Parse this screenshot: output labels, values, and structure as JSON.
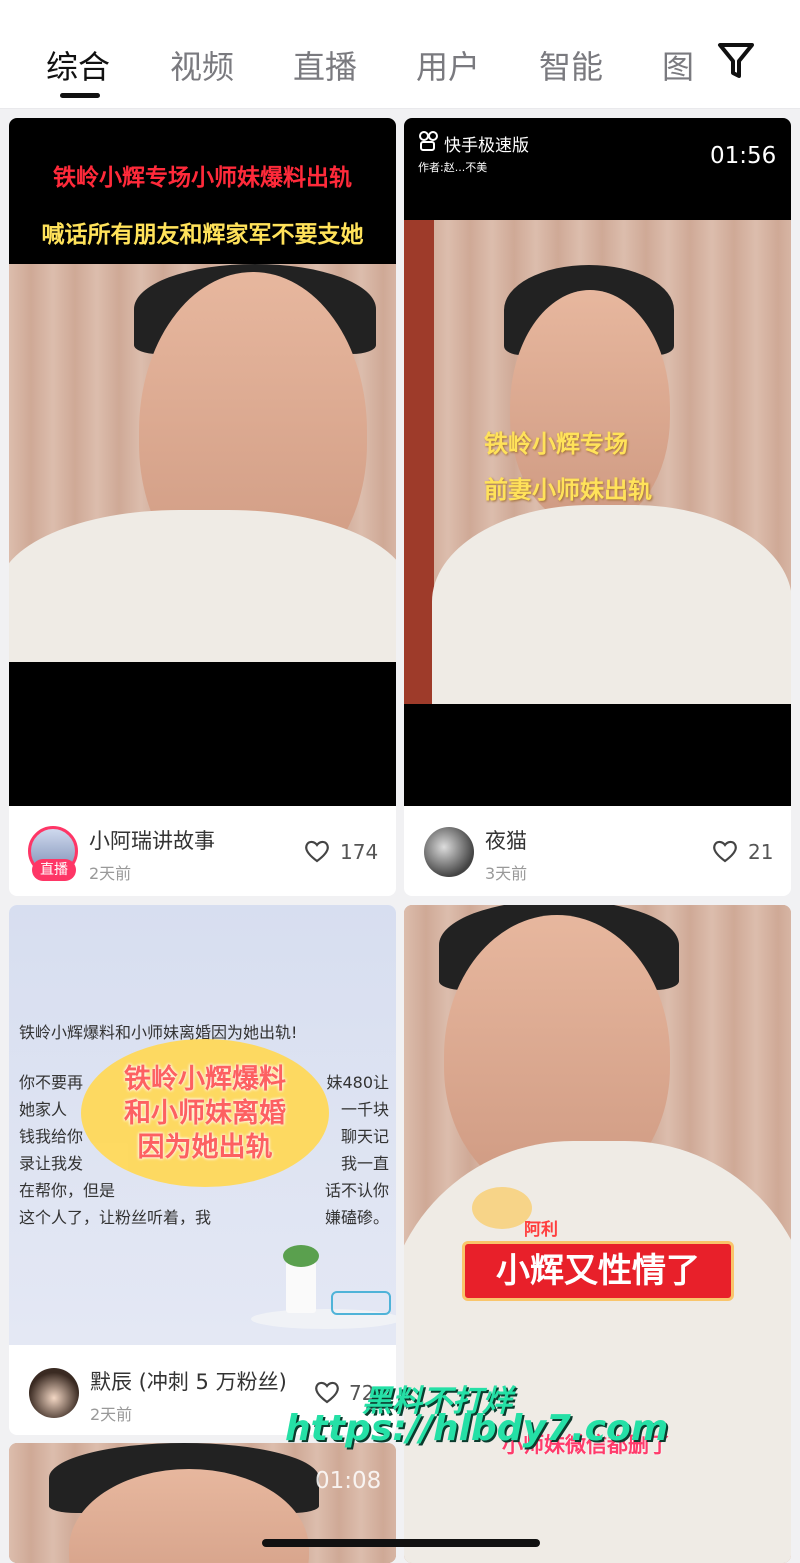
{
  "tabs": [
    {
      "label": "综合",
      "active": true
    },
    {
      "label": "视频",
      "active": false
    },
    {
      "label": "直播",
      "active": false
    },
    {
      "label": "用户",
      "active": false
    },
    {
      "label": "智能",
      "active": false
    },
    {
      "label": "图",
      "active": false
    }
  ],
  "cards": {
    "c1": {
      "caption_line1": "铁岭小辉专场小师妹爆料出轨",
      "caption_line2": "喊话所有朋友和辉家军不要支她",
      "author": "小阿瑞讲故事",
      "time": "2天前",
      "likes": "174",
      "live_badge": "直播"
    },
    "c2": {
      "brand": "快手极速版",
      "byline": "作者:赵...不美",
      "duration": "01:56",
      "caption_line1": "铁岭小辉专场",
      "caption_line2": "前妻小师妹出轨",
      "author": "夜猫",
      "time": "3天前",
      "likes": "21"
    },
    "c3": {
      "title": "铁岭小辉爆料和小师妹离婚因为她出轨!",
      "body_line1": "你不要再",
      "body_line1_end": "妹480让",
      "body_line2": "她家人",
      "body_line2_end": "一千块",
      "body_line3": "钱我给你",
      "body_line3_end": "聊天记",
      "body_line4": "录让我发",
      "body_line4_end": "我一直",
      "body_line5": "在帮你，但是",
      "body_line5_end": "话不认你",
      "body_line6": "这个人了，让粉丝听着，我",
      "body_line6_end": "嫌磕碜。",
      "bubble_line1": "铁岭小辉爆料",
      "bubble_line2": "和小师妹离婚",
      "bubble_line3": "因为她出轨",
      "author": "默辰 (冲刺 5 万粉丝)",
      "time": "2天前",
      "likes": "72"
    },
    "c4": {
      "sticker_name": "阿利",
      "banner": "小辉又性情了",
      "subtitle": "小师妹微信都删了"
    },
    "c5": {
      "duration": "01:08"
    }
  },
  "watermark": {
    "line1": "黑料不打烊",
    "line2": "https://hlbdy7.com"
  },
  "icons": {
    "filter": "filter-funnel-icon",
    "heart": "heart-outline-icon",
    "kuaishou": "kuaishou-logo-icon"
  },
  "colors": {
    "tab_active": "#111111",
    "tab_inactive": "#7a7a7f",
    "live_badge": "#fe3666",
    "caption_red": "#ff2a3a",
    "caption_yellow": "#ffe25a",
    "watermark": "#25e0a6"
  }
}
